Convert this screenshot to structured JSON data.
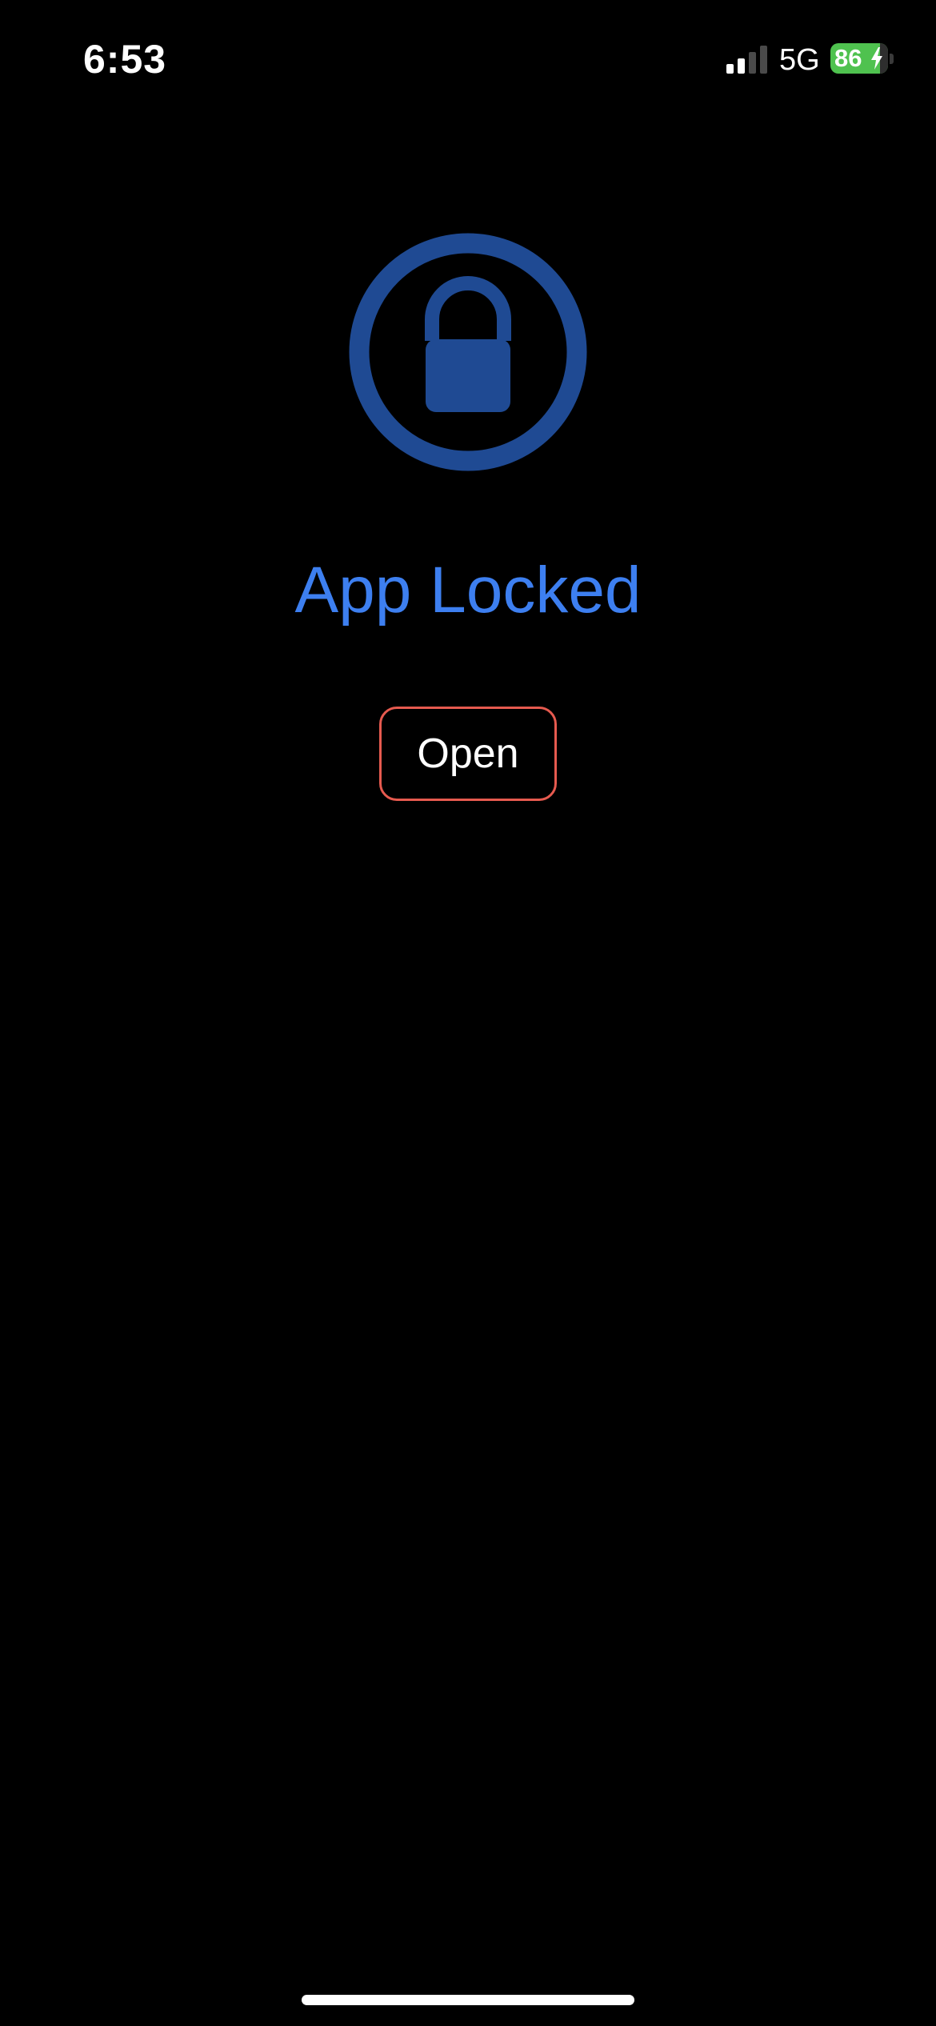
{
  "status_bar": {
    "time": "6:53",
    "network": "5G",
    "battery_percent": "86",
    "battery_level": 0.86,
    "battery_charging": true,
    "signal_bars_active": 2,
    "signal_bars_total": 4
  },
  "lock_screen": {
    "icon": "lock-icon",
    "title": "App Locked",
    "open_label": "Open"
  },
  "colors": {
    "background": "#000000",
    "lock_icon": "#1f4a93",
    "title": "#3d7ff0",
    "button_border": "#e65a4f",
    "battery": "#4fc24f"
  }
}
